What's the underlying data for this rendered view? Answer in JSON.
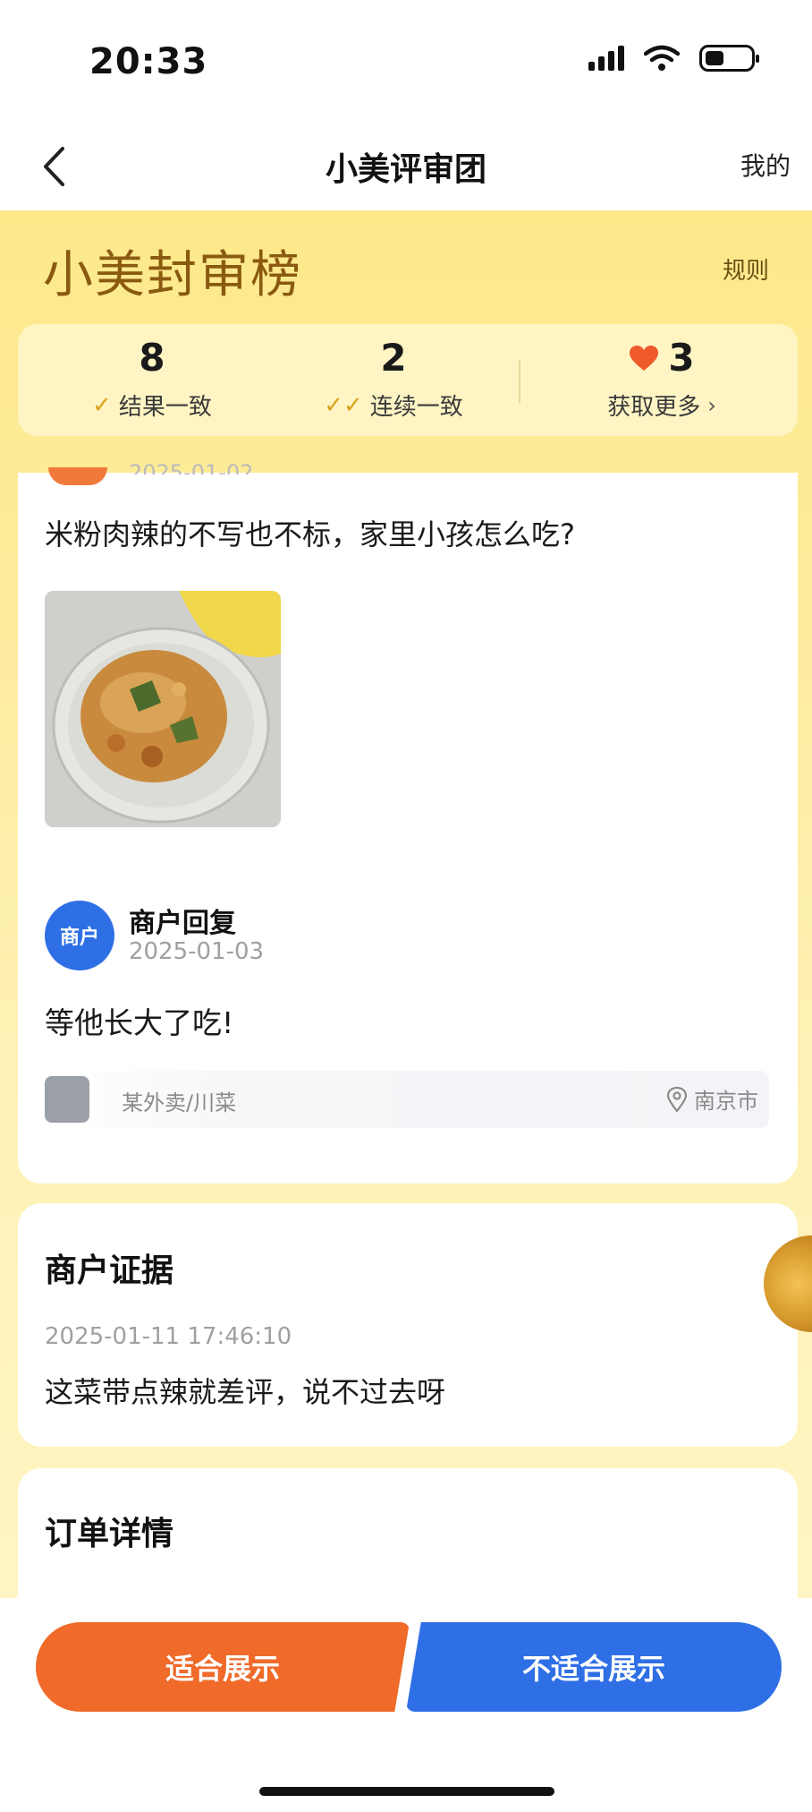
{
  "status_bar": {
    "time": "20:33"
  },
  "nav": {
    "title": "小美评审团",
    "right_link": "我的"
  },
  "banner": {
    "title": "小美封审榜",
    "rules": "规则"
  },
  "stats": [
    {
      "value": "8",
      "label": "结果一致"
    },
    {
      "value": "2",
      "label": "连续一致"
    },
    {
      "value": "3",
      "label": "获取更多"
    }
  ],
  "review": {
    "date_partial": "2025-01-02",
    "text": "米粉肉辣的不写也不标，家里小孩怎么吃?"
  },
  "merchant_reply": {
    "avatar_text": "商户",
    "title": "商户回复",
    "date": "2025-01-03",
    "text": "等他长大了吃!"
  },
  "shop": {
    "name": "某外卖/川菜",
    "location": "南京市"
  },
  "evidence": {
    "title": "商户证据",
    "time": "2025-01-11 17:46:10",
    "text": "这菜带点辣就差评，说不过去呀"
  },
  "order": {
    "title": "订单详情"
  },
  "actions": {
    "suitable": "适合展示",
    "unsuitable": "不适合展示"
  },
  "colors": {
    "accent_orange": "#f06a2a",
    "accent_blue": "#2f6fe6",
    "banner_yellow": "#fde98a"
  }
}
